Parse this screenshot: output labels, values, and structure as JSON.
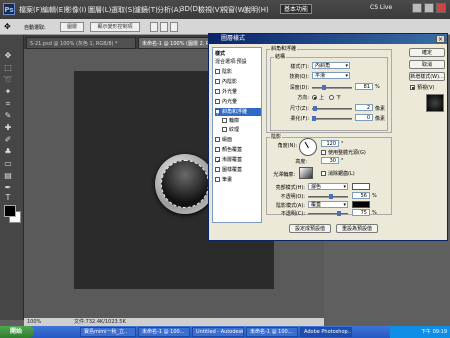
{
  "menubar": {
    "logo": "Ps",
    "items": [
      "檔案(F)",
      "編輯(E)",
      "影像(I)",
      "圖層(L)",
      "選取(S)",
      "濾鏡(T)",
      "分析(A)",
      "3D(D)",
      "檢視(V)",
      "視窗(W)",
      "說明(H)"
    ],
    "workspace": "基本功能",
    "cslive": "CS Live"
  },
  "optionsbar": {
    "checkbox_label": "自動選取:",
    "btn1": "圖層",
    "btn2": "顯示變形控制項"
  },
  "tabs": [
    "5-21.psd @ 100% (灰色 1, RGB/8) *",
    "未命名-1 @ 100% (圖層 2, RGB/8) *"
  ],
  "status": {
    "zoom": "100%",
    "doc": "文件:732.4K/1023.5K"
  },
  "dialog": {
    "title": "圖層樣式",
    "close": "×",
    "styles_header": "樣式",
    "blending": "混合選項:預設",
    "styles": [
      {
        "label": "陰影",
        "checked": false
      },
      {
        "label": "內陰影",
        "checked": false
      },
      {
        "label": "外光暈",
        "checked": false
      },
      {
        "label": "內光暈",
        "checked": false
      },
      {
        "label": "斜角和浮雕",
        "checked": true,
        "selected": true
      },
      {
        "label": "輪廓",
        "checked": false,
        "sub": true
      },
      {
        "label": "紋理",
        "checked": false,
        "sub": true
      },
      {
        "label": "緞面",
        "checked": false
      },
      {
        "label": "顏色覆蓋",
        "checked": false
      },
      {
        "label": "漸層覆蓋",
        "checked": true
      },
      {
        "label": "圖樣覆蓋",
        "checked": false
      },
      {
        "label": "筆畫",
        "checked": false
      }
    ],
    "section_bevel": "斜角和浮雕",
    "section_structure": "結構",
    "style_label": "樣式(T):",
    "style_value": "內斜角",
    "technique_label": "技術(Q):",
    "technique_value": "平滑",
    "depth_label": "深度(D):",
    "depth_value": "81",
    "depth_unit": "%",
    "direction_label": "方向:",
    "dir_up": "上",
    "dir_down": "下",
    "size_label": "尺寸(Z):",
    "size_value": "2",
    "size_unit": "像素",
    "soften_label": "柔化(F):",
    "soften_value": "0",
    "soften_unit": "像素",
    "section_shading": "陰影",
    "angle_label": "角度(N):",
    "angle_value": "120",
    "angle_unit": "°",
    "global_light": "使用整體光源(G)",
    "altitude_label": "高度:",
    "altitude_value": "30",
    "altitude_unit": "°",
    "gloss_label": "光澤輪廓:",
    "antialias": "消除鋸齒(L)",
    "highlight_label": "亮部模式(H):",
    "highlight_value": "濾色",
    "hl_opacity_label": "不透明(O):",
    "hl_opacity_value": "56",
    "shadow_label": "陰影模式(A):",
    "shadow_value": "覆蓋",
    "sh_opacity_label": "不透明(C):",
    "sh_opacity_value": "75",
    "pct": "%",
    "btn_default": "設定成預設值",
    "btn_reset": "重設為預設值",
    "btn_ok": "確定",
    "btn_cancel": "取消",
    "btn_newstyle": "新增樣式(W)...",
    "preview_label": "預視(V)"
  },
  "taskbar": {
    "start": "開始",
    "tasks": [
      "寶島mimi一秋_立..",
      "未命名-1 @ 100...",
      "Untitled - Autodesk...",
      "未命名-1 @ 100...",
      "Adobe Photoshop..."
    ],
    "time": "下午 09:19"
  }
}
